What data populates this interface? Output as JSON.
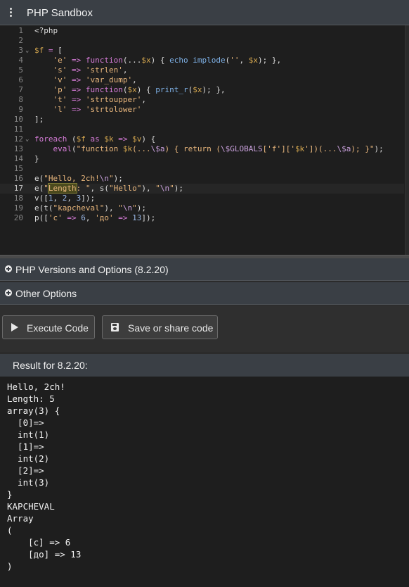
{
  "app": {
    "title": "PHP Sandbox"
  },
  "editor": {
    "lines": [
      {
        "n": "1",
        "fold": "",
        "html": "&lt;?php"
      },
      {
        "n": "2",
        "fold": "",
        "html": ""
      },
      {
        "n": "3",
        "fold": "v",
        "html": "<span class=\"var\">$f</span> <span class=\"op\">=</span> ["
      },
      {
        "n": "4",
        "fold": "",
        "html": "    <span class=\"str\">'e'</span> <span class=\"op\">=&gt;</span> <span class=\"kw\">function</span>(...<span class=\"var\">$x</span>) { <span class=\"fn\">echo</span> <span class=\"fn\">implode</span>(<span class=\"str\">''</span>, <span class=\"var\">$x</span>); },"
      },
      {
        "n": "5",
        "fold": "",
        "html": "    <span class=\"str\">'s'</span> <span class=\"op\">=&gt;</span> <span class=\"str\">'strlen'</span>,"
      },
      {
        "n": "6",
        "fold": "",
        "html": "    <span class=\"str\">'v'</span> <span class=\"op\">=&gt;</span> <span class=\"str\">'var_dump'</span>,"
      },
      {
        "n": "7",
        "fold": "",
        "html": "    <span class=\"str\">'p'</span> <span class=\"op\">=&gt;</span> <span class=\"kw\">function</span>(<span class=\"var\">$x</span>) { <span class=\"fn\">print_r</span>(<span class=\"var\">$x</span>); },"
      },
      {
        "n": "8",
        "fold": "",
        "html": "    <span class=\"str\">'t'</span> <span class=\"op\">=&gt;</span> <span class=\"str\">'strtoupper'</span>,"
      },
      {
        "n": "9",
        "fold": "",
        "html": "    <span class=\"str\">'l'</span> <span class=\"op\">=&gt;</span> <span class=\"str\">'strtolower'</span>"
      },
      {
        "n": "10",
        "fold": "",
        "html": "];"
      },
      {
        "n": "11",
        "fold": "",
        "html": ""
      },
      {
        "n": "12",
        "fold": "v",
        "html": "<span class=\"kw\">foreach</span> (<span class=\"var\">$f</span> <span class=\"kw\">as</span> <span class=\"var\">$k</span> <span class=\"op\">=&gt;</span> <span class=\"var\">$v</span>) {"
      },
      {
        "n": "13",
        "fold": "",
        "html": "    <span class=\"kw\">eval</span>(<span class=\"str\">\"function <span class=\"var\">$k</span>(...<span class=\"esc\">\\$a</span>) { return (<span class=\"esc\">\\$GLOBALS</span>['f']['<span class=\"var\">$k</span>'])(...<span class=\"esc\">\\$a</span>); }\"</span>);"
      },
      {
        "n": "14",
        "fold": "",
        "html": "}"
      },
      {
        "n": "15",
        "fold": "",
        "html": ""
      },
      {
        "n": "16",
        "fold": "",
        "html": "e(<span class=\"str\">\"Hello, 2ch!<span class=\"esc\">\\n</span>\"</span>);"
      },
      {
        "n": "17",
        "fold": "",
        "html": "e(<span class=\"str\">\"<span class=\"hl\">Length</span>: \"</span>, s(<span class=\"str\">\"Hello\"</span>), <span class=\"str\">\"<span class=\"esc\">\\n</span>\"</span>);",
        "current": true
      },
      {
        "n": "18",
        "fold": "",
        "html": "v([<span class=\"num\">1</span>, <span class=\"num\">2</span>, <span class=\"num\">3</span>]);"
      },
      {
        "n": "19",
        "fold": "",
        "html": "e(t(<span class=\"str\">\"kapcheval\"</span>), <span class=\"str\">\"<span class=\"esc\">\\n</span>\"</span>);"
      },
      {
        "n": "20",
        "fold": "",
        "html": "p([<span class=\"str\">'c'</span> <span class=\"op\">=&gt;</span> <span class=\"num\">6</span>, <span class=\"str\">'до'</span> <span class=\"op\">=&gt;</span> <span class=\"num\">13</span>]);"
      }
    ]
  },
  "sections": {
    "versions": "PHP Versions and Options (8.2.20)",
    "other": "Other Options"
  },
  "buttons": {
    "execute": "Execute Code",
    "save": "Save or share code"
  },
  "result": {
    "header": "Result for 8.2.20:",
    "lines": [
      "Hello, 2ch!",
      "Length: 5",
      "array(3) {",
      "  [0]=>",
      "  int(1)",
      "  [1]=>",
      "  int(2)",
      "  [2]=>",
      "  int(3)",
      "}",
      "KAPCHEVAL",
      "Array",
      "(",
      "    [c] => 6",
      "    [до] => 13",
      ")"
    ]
  }
}
